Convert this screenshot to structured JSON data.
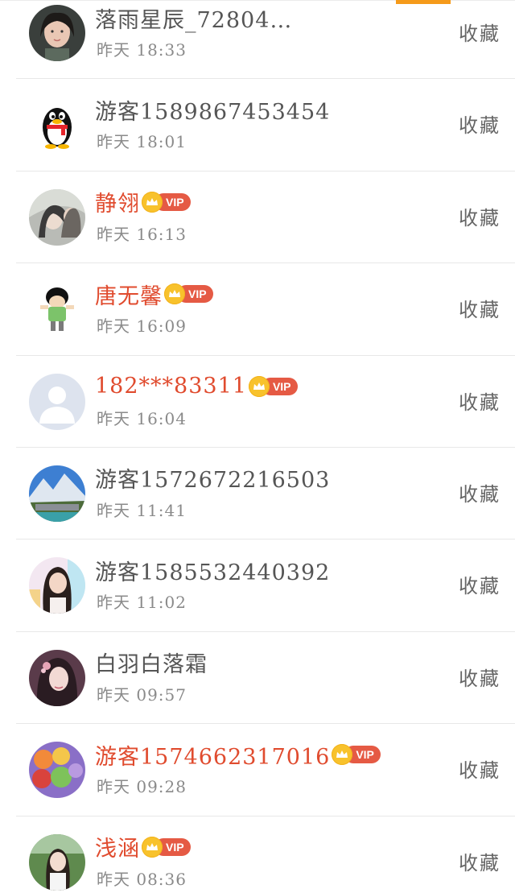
{
  "list": {
    "items": [
      {
        "name": "落雨星辰_72804…",
        "time": "昨天 18:33",
        "vip": false,
        "action": "收藏",
        "avatar": "user-photo-avatar"
      },
      {
        "name": "游客1589867453454",
        "time": "昨天 18:01",
        "vip": false,
        "action": "收藏",
        "avatar": "qq-penguin-avatar"
      },
      {
        "name": "静翎",
        "time": "昨天 16:13",
        "vip": true,
        "vip_label": "VIP",
        "action": "收藏",
        "avatar": "illustration-avatar"
      },
      {
        "name": "唐无馨",
        "time": "昨天 16:09",
        "vip": true,
        "vip_label": "VIP",
        "action": "收藏",
        "avatar": "cartoon-kid-avatar"
      },
      {
        "name": "182***83311",
        "time": "昨天 16:04",
        "vip": true,
        "vip_label": "VIP",
        "action": "收藏",
        "avatar": "default-user-avatar"
      },
      {
        "name": "游客1572672216503",
        "time": "昨天 11:41",
        "vip": false,
        "action": "收藏",
        "avatar": "landscape-avatar"
      },
      {
        "name": "游客1585532440392",
        "time": "昨天 11:02",
        "vip": false,
        "action": "收藏",
        "avatar": "girl-photo-avatar"
      },
      {
        "name": "白羽白落霜",
        "time": "昨天 09:57",
        "vip": false,
        "action": "收藏",
        "avatar": "anime-girl-avatar"
      },
      {
        "name": "游客1574662317016",
        "time": "昨天 09:28",
        "vip": true,
        "vip_label": "VIP",
        "action": "收藏",
        "avatar": "macaron-avatar"
      },
      {
        "name": "浅涵",
        "time": "昨天 08:36",
        "vip": true,
        "vip_label": "VIP",
        "action": "收藏",
        "avatar": "girl-outdoor-avatar"
      }
    ]
  },
  "colors": {
    "accent": "#f59a1a",
    "vip_name": "#e04b2e",
    "vip_badge": "#e55a44",
    "crown": "#f8c22c",
    "name": "#555555",
    "time": "#8a8a8a"
  }
}
